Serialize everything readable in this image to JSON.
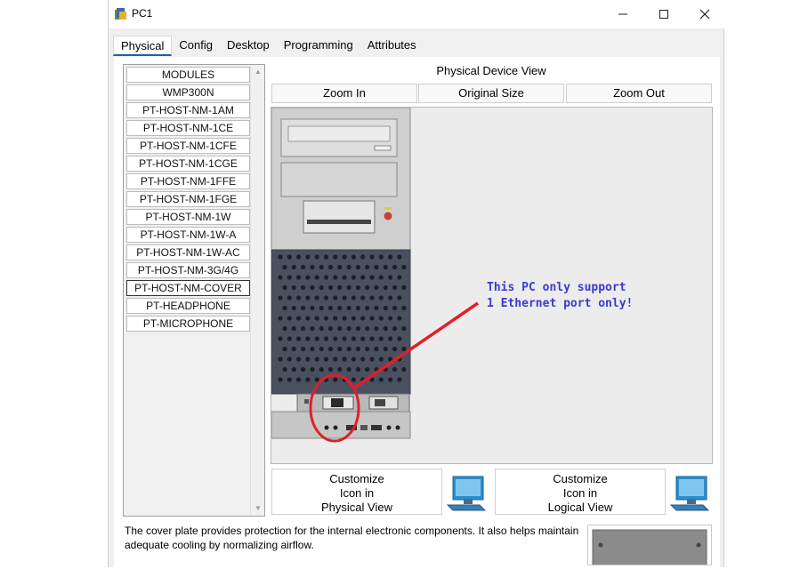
{
  "window": {
    "title": "PC1",
    "controls": {
      "minimize": "—",
      "maximize": "☐",
      "close": "✕"
    }
  },
  "tabs": [
    {
      "label": "Physical",
      "active": true
    },
    {
      "label": "Config",
      "active": false
    },
    {
      "label": "Desktop",
      "active": false
    },
    {
      "label": "Programming",
      "active": false
    },
    {
      "label": "Attributes",
      "active": false
    }
  ],
  "modules": {
    "items": [
      "MODULES",
      "WMP300N",
      "PT-HOST-NM-1AM",
      "PT-HOST-NM-1CE",
      "PT-HOST-NM-1CFE",
      "PT-HOST-NM-1CGE",
      "PT-HOST-NM-1FFE",
      "PT-HOST-NM-1FGE",
      "PT-HOST-NM-1W",
      "PT-HOST-NM-1W-A",
      "PT-HOST-NM-1W-AC",
      "PT-HOST-NM-3G/4G",
      "PT-HOST-NM-COVER",
      "PT-HEADPHONE",
      "PT-MICROPHONE"
    ],
    "selected": "PT-HOST-NM-COVER"
  },
  "view": {
    "title": "Physical Device View",
    "zoom_in": "Zoom In",
    "original_size": "Original Size",
    "zoom_out": "Zoom Out",
    "annotation_line1": "This PC only support",
    "annotation_line2": "1 Ethernet port only!",
    "annotation_color": "#3a3ad0",
    "highlight_color": "#e01f2a"
  },
  "customize": {
    "physical": [
      "Customize",
      "Icon in",
      "Physical View"
    ],
    "logical": [
      "Customize",
      "Icon in",
      "Logical View"
    ]
  },
  "description": "The cover plate provides protection for the internal electronic components. It also helps maintain adequate cooling by normalizing airflow."
}
